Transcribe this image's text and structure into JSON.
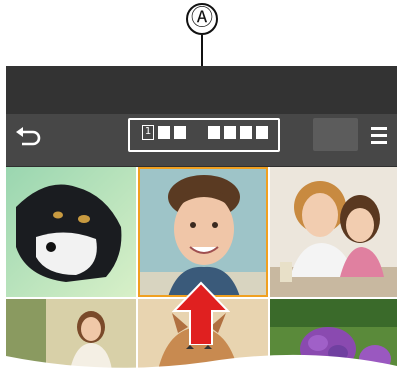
{
  "callout": {
    "label": "Ⓐ"
  },
  "slot_indicator": {
    "slot_number": "1"
  },
  "colors": {
    "selection_border": "#f0a020",
    "arrow": "#e02020",
    "toolbar": "#474747",
    "top_band": "#333333"
  },
  "icons": {
    "back": "return-arrow-icon",
    "menu": "hamburger-menu-icon",
    "arrow": "up-arrow-icon"
  }
}
